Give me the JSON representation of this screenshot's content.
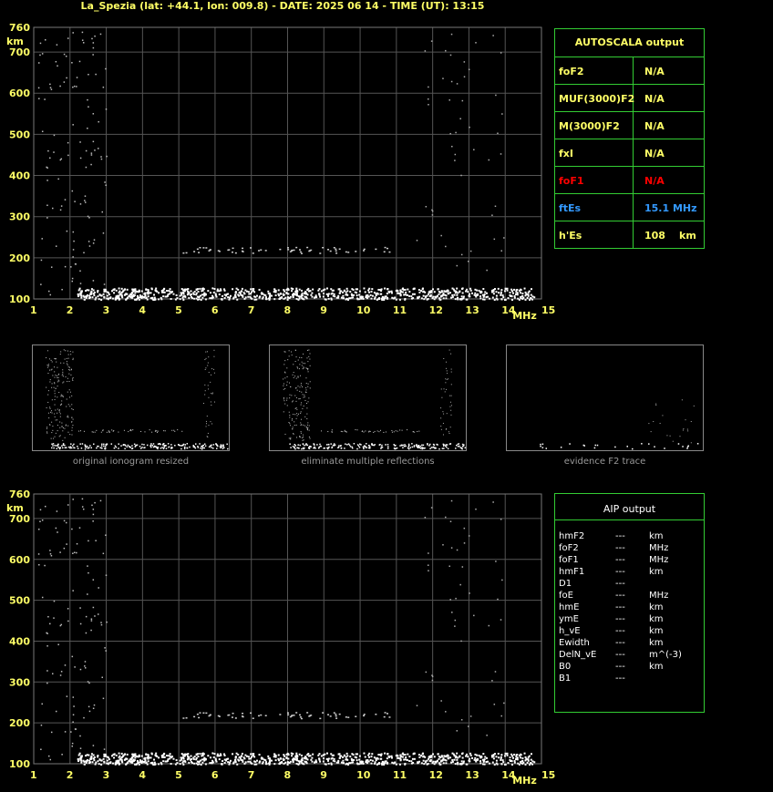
{
  "header": {
    "title": "La_Spezia (lat: +44.1, lon: 009.8) - DATE: 2025 06 14 - TIME (UT): 13:15"
  },
  "colors": {
    "grid": "#555555",
    "axis_text": "#ffff66",
    "box_border": "#33cc33",
    "foF1": "#ff0000",
    "ftEs": "#3399ff"
  },
  "chart_data": [
    {
      "type": "scatter",
      "name": "ionogram-top",
      "xlabel": "MHz",
      "ylabel": "km",
      "xlim": [
        1,
        15
      ],
      "ylim": [
        100,
        760
      ],
      "x_ticks": [
        "1",
        "2",
        "3",
        "4",
        "5",
        "6",
        "7",
        "8",
        "9",
        "10",
        "11",
        "12",
        "13",
        "14",
        "15"
      ],
      "y_ticks": [
        "100",
        "200",
        "300",
        "400",
        "500",
        "600",
        "700",
        "760"
      ],
      "grid": true
    },
    {
      "type": "scatter",
      "name": "ionogram-bottom",
      "xlabel": "MHz",
      "ylabel": "km",
      "xlim": [
        1,
        15
      ],
      "ylim": [
        100,
        760
      ],
      "x_ticks": [
        "1",
        "2",
        "3",
        "4",
        "5",
        "6",
        "7",
        "8",
        "9",
        "10",
        "11",
        "12",
        "13",
        "14",
        "15"
      ],
      "y_ticks": [
        "100",
        "200",
        "300",
        "400",
        "500",
        "600",
        "700",
        "760"
      ],
      "grid": true
    }
  ],
  "autoscala": {
    "title": "AUTOSCALA output",
    "rows": [
      {
        "label": "foF2",
        "value": "N/A",
        "color": "#ffff66"
      },
      {
        "label": "MUF(3000)F2",
        "value": "N/A",
        "color": "#ffff66"
      },
      {
        "label": "M(3000)F2",
        "value": "N/A",
        "color": "#ffff66"
      },
      {
        "label": "fxI",
        "value": "N/A",
        "color": "#ffff66"
      },
      {
        "label": "foF1",
        "value": "N/A",
        "color": "#ff0000"
      },
      {
        "label": "ftEs",
        "value": "15.1 MHz",
        "color": "#3399ff"
      },
      {
        "label": "h'Es",
        "value": "108",
        "unit": "km",
        "color": "#ffff66"
      }
    ]
  },
  "thumbnails": [
    {
      "caption": "original ionogram resized"
    },
    {
      "caption": "eliminate multiple reflections"
    },
    {
      "caption": "evidence F2 trace"
    }
  ],
  "aip": {
    "title": "AIP output",
    "rows": [
      {
        "label": "hmF2",
        "value": "---",
        "unit": "km"
      },
      {
        "label": "foF2",
        "value": "---",
        "unit": "MHz"
      },
      {
        "label": "foF1",
        "value": "---",
        "unit": "MHz"
      },
      {
        "label": "hmF1",
        "value": "---",
        "unit": "km"
      },
      {
        "label": "D1",
        "value": "---",
        "unit": ""
      },
      {
        "label": "foE",
        "value": "---",
        "unit": "MHz"
      },
      {
        "label": "hmE",
        "value": "---",
        "unit": "km"
      },
      {
        "label": "ymE",
        "value": "---",
        "unit": "km"
      },
      {
        "label": "h_vE",
        "value": "---",
        "unit": "km"
      },
      {
        "label": "Ewidth",
        "value": "---",
        "unit": "km"
      },
      {
        "label": "DelN_vE",
        "value": "---",
        "unit": "m^(-3)"
      },
      {
        "label": "B0",
        "value": "---",
        "unit": "km"
      },
      {
        "label": "B1",
        "value": "---",
        "unit": ""
      }
    ]
  }
}
